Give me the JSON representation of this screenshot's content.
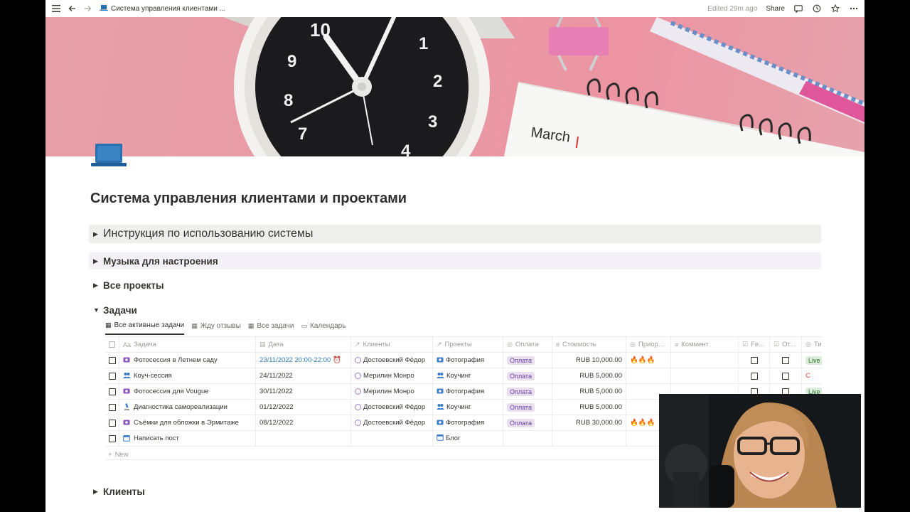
{
  "topbar": {
    "title": "Система управления клиентами ...",
    "edited": "Edited 29m ago",
    "share": "Share"
  },
  "banner": {
    "notepad_text": "March"
  },
  "page": {
    "title": "Система управления клиентами и проектами"
  },
  "toggles": [
    {
      "label": "Инструкция по использованию системы"
    },
    {
      "label": "Музыка для настроения"
    },
    {
      "label": "Все проекты"
    },
    {
      "label": "Задачи"
    },
    {
      "label": "Клиенты"
    }
  ],
  "tabs": [
    {
      "label": "Все активные задачи"
    },
    {
      "label": "Жду отзывы"
    },
    {
      "label": "Все задачи"
    },
    {
      "label": "Календарь"
    }
  ],
  "table": {
    "headers": [
      "Задача",
      "Дата",
      "Клиенты",
      "Проекты",
      "Оплата",
      "Стоимость",
      "Приор...",
      "Коммент",
      "Fe...",
      "От...",
      "Ти"
    ],
    "rows": [
      {
        "task": "Фотосессия в Летнем саду",
        "date": "23/11/2022 20:00-22:00",
        "client": "Достоевский Фёдор",
        "project": "Фотография",
        "payment": "Оплата",
        "cost": "RUB 10,000.00",
        "priority": "🔥🔥🔥",
        "type": "Live",
        "icon": "camera"
      },
      {
        "task": "Коуч-сессия",
        "date": "24/11/2022",
        "client": "Мерилин Монро",
        "project": "Коучинг",
        "payment": "Оплата",
        "cost": "RUB 5,000.00",
        "priority": "",
        "type": "С",
        "icon": "people"
      },
      {
        "task": "Фотосессия для Vougue",
        "date": "30/11/2022",
        "client": "Мерилин Монро",
        "project": "Фотография",
        "payment": "Оплата",
        "cost": "RUB 5,000.00",
        "priority": "",
        "type": "Live",
        "icon": "camera"
      },
      {
        "task": "Диагностика самореализации",
        "date": "01/12/2022",
        "client": "Достоевский Фёдор",
        "project": "Коучинг",
        "payment": "Оплата",
        "cost": "RUB 5,000.00",
        "priority": "",
        "type": "",
        "icon": "microscope"
      },
      {
        "task": "Съёмки для обложки в Эрмитаже",
        "date": "08/12/2022",
        "client": "Достоевский Фёдор",
        "project": "Фотография",
        "payment": "Оплата",
        "cost": "RUB 30,000.00",
        "priority": "🔥🔥🔥",
        "type": "",
        "icon": "camera"
      },
      {
        "task": "Написать пост",
        "date": "",
        "client": "",
        "project": "Блог",
        "payment": "",
        "cost": "",
        "priority": "",
        "type": "",
        "icon": "calendar"
      }
    ],
    "new_label": "New"
  },
  "colors": {
    "accent": "#2e7ab5",
    "banner": "#ea9aa6",
    "payment_tag": "#e8deee",
    "live_tag": "#dbeddb"
  }
}
